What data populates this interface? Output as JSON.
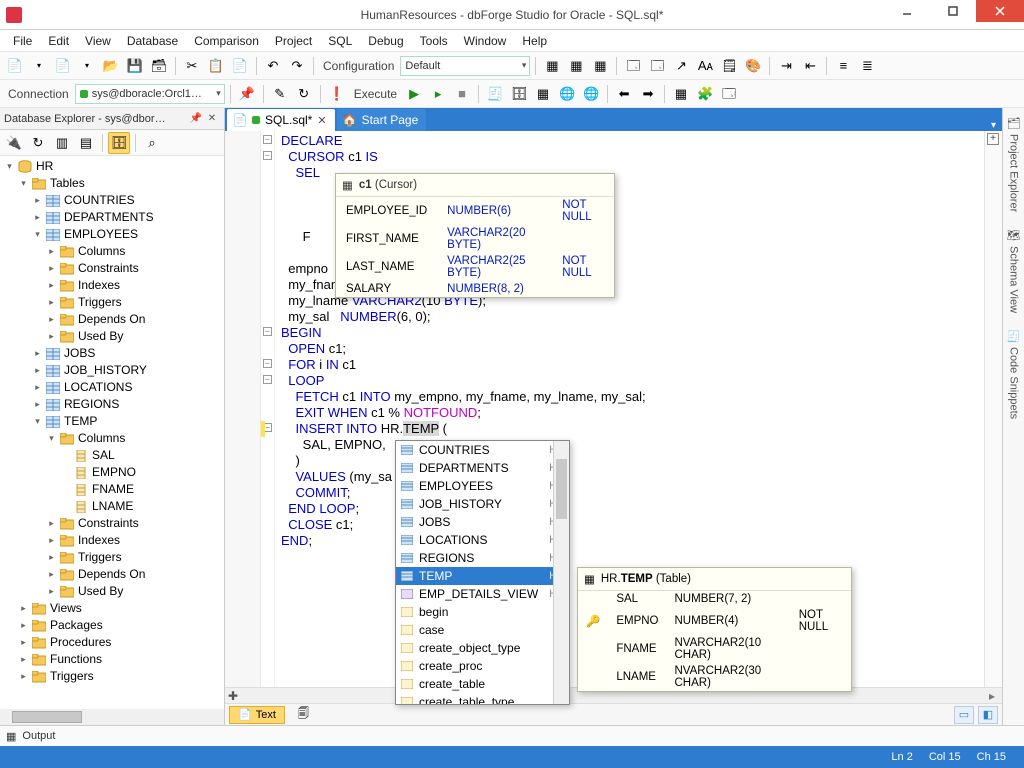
{
  "window": {
    "title": "HumanResources - dbForge Studio for Oracle - SQL.sql*"
  },
  "menu": [
    "File",
    "Edit",
    "View",
    "Database",
    "Comparison",
    "Project",
    "SQL",
    "Debug",
    "Tools",
    "Window",
    "Help"
  ],
  "toolbar1": {
    "config_label": "Configuration",
    "config_value": "Default"
  },
  "toolbar2": {
    "conn_label": "Connection",
    "conn_value": "sys@dboracle:Orcl1…",
    "execute_label": "Execute"
  },
  "db_explorer": {
    "title": "Database Explorer - sys@dbor…",
    "root": "HR",
    "tables_label": "Tables",
    "tables": [
      "COUNTRIES",
      "DEPARTMENTS",
      "EMPLOYEES",
      "JOBS",
      "JOB_HISTORY",
      "LOCATIONS",
      "REGIONS",
      "TEMP"
    ],
    "emp_children": [
      "Columns",
      "Constraints",
      "Indexes",
      "Triggers",
      "Depends On",
      "Used By"
    ],
    "temp_columns": [
      "SAL",
      "EMPNO",
      "FNAME",
      "LNAME"
    ],
    "temp_children_after_cols": [
      "Constraints",
      "Indexes",
      "Triggers",
      "Depends On",
      "Used By"
    ],
    "hr_other": [
      "Views",
      "Packages",
      "Procedures",
      "Functions",
      "Triggers"
    ]
  },
  "doc_tabs": {
    "active": "SQL.sql*",
    "inactive": "Start Page"
  },
  "code": {
    "lines": [
      "DECLARE",
      "  CURSOR c1 IS",
      "    SEL",
      "",
      "",
      "",
      "      F",
      "",
      "  empno",
      "  my_fname VARCHAR2(10 BYTE);",
      "  my_lname VARCHAR2(10 BYTE);",
      "  my_sal   NUMBER(6, 0);",
      "BEGIN",
      "  OPEN c1;",
      "  FOR i IN c1",
      "  LOOP",
      "    FETCH c1 INTO my_empno, my_fname, my_lname, my_sal;",
      "    EXIT WHEN c1 % NOTFOUND;",
      "    INSERT INTO HR.TEMP (",
      "      SAL, EMPNO,",
      "    )",
      "    VALUES (my_sa                     my_lname);",
      "    COMMIT;",
      "  END LOOP;",
      "  CLOSE c1;",
      "END;"
    ]
  },
  "cursor_tip": {
    "head_name": "c1",
    "head_kind": "(Cursor)",
    "cols": [
      {
        "name": "EMPLOYEE_ID",
        "type": "NUMBER(6)",
        "null": "NOT NULL"
      },
      {
        "name": "FIRST_NAME",
        "type": "VARCHAR2(20 BYTE)",
        "null": ""
      },
      {
        "name": "LAST_NAME",
        "type": "VARCHAR2(25 BYTE)",
        "null": "NOT NULL"
      },
      {
        "name": "SALARY",
        "type": "NUMBER(8, 2)",
        "null": ""
      }
    ]
  },
  "autocomplete": {
    "items": [
      {
        "label": "COUNTRIES",
        "schema": "HR",
        "kind": "table"
      },
      {
        "label": "DEPARTMENTS",
        "schema": "HR",
        "kind": "table"
      },
      {
        "label": "EMPLOYEES",
        "schema": "HR",
        "kind": "table"
      },
      {
        "label": "JOB_HISTORY",
        "schema": "HR",
        "kind": "table"
      },
      {
        "label": "JOBS",
        "schema": "HR",
        "kind": "table"
      },
      {
        "label": "LOCATIONS",
        "schema": "HR",
        "kind": "table"
      },
      {
        "label": "REGIONS",
        "schema": "HR",
        "kind": "table"
      },
      {
        "label": "TEMP",
        "schema": "HR",
        "kind": "table",
        "selected": true
      },
      {
        "label": "EMP_DETAILS_VIEW",
        "schema": "HR",
        "kind": "view"
      },
      {
        "label": "begin",
        "schema": "",
        "kind": "snippet"
      },
      {
        "label": "case",
        "schema": "",
        "kind": "snippet"
      },
      {
        "label": "create_object_type",
        "schema": "",
        "kind": "snippet"
      },
      {
        "label": "create_proc",
        "schema": "",
        "kind": "snippet"
      },
      {
        "label": "create_table",
        "schema": "",
        "kind": "snippet"
      },
      {
        "label": "create_table_type",
        "schema": "",
        "kind": "snippet"
      }
    ]
  },
  "table_tip": {
    "head": "HR.TEMP",
    "kind": "(Table)",
    "cols": [
      {
        "key": "",
        "name": "SAL",
        "type": "NUMBER(7, 2)",
        "null": ""
      },
      {
        "key": "pk",
        "name": "EMPNO",
        "type": "NUMBER(4)",
        "null": "NOT NULL"
      },
      {
        "key": "",
        "name": "FNAME",
        "type": "NVARCHAR2(10 CHAR)",
        "null": ""
      },
      {
        "key": "",
        "name": "LNAME",
        "type": "NVARCHAR2(30 CHAR)",
        "null": ""
      }
    ]
  },
  "bottom_tabs": {
    "text": "Text"
  },
  "output": {
    "label": "Output"
  },
  "status": {
    "ln": "Ln 2",
    "col": "Col 15",
    "ch": "Ch 15"
  },
  "right_tabs": [
    "Project Explorer",
    "Schema View",
    "Code Snippets"
  ]
}
